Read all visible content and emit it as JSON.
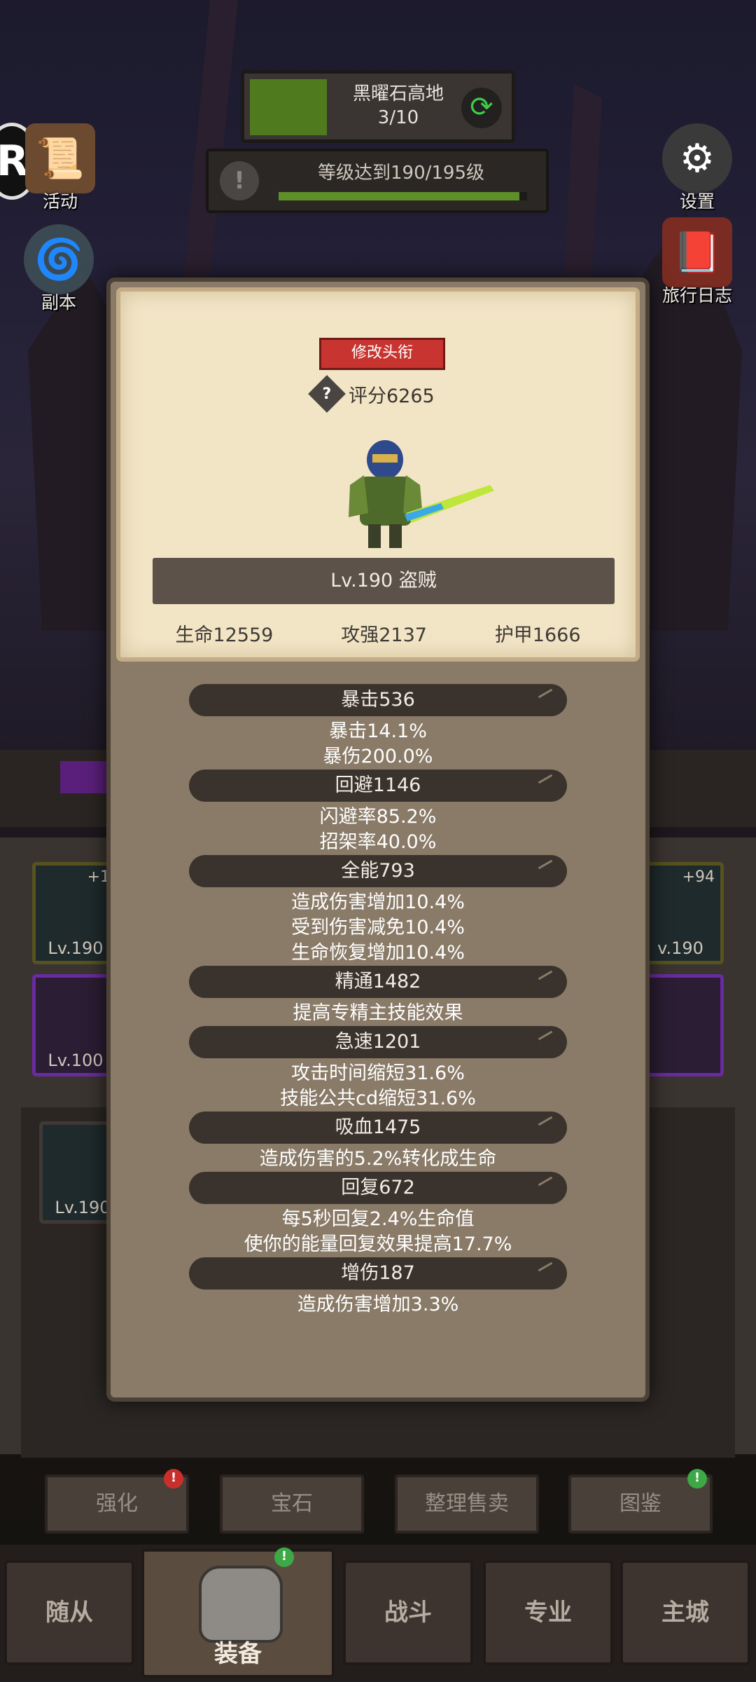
{
  "zone": {
    "name": "黑曜石高地",
    "progress_text": "3/10",
    "progress_fraction": 0.3
  },
  "quest": {
    "text": "等级达到190/195级",
    "progress_fraction": 0.97
  },
  "left_buttons": [
    {
      "label": "活动",
      "icon": "scroll-icon"
    },
    {
      "label": "副本",
      "icon": "portal-icon"
    }
  ],
  "right_buttons": [
    {
      "label": "设置",
      "icon": "gear-icon"
    },
    {
      "label": "旅行日志",
      "icon": "journal-icon"
    }
  ],
  "badge": {
    "letter": "R"
  },
  "inventory_slots": {
    "left_top": {
      "lv": "Lv.190",
      "plus": "+1"
    },
    "left_bottom": {
      "lv": "Lv.100"
    },
    "right_top": {
      "lv": "v.190",
      "plus": "+94"
    },
    "bag_first": {
      "lv": "Lv.190"
    }
  },
  "actions": [
    {
      "label": "强化",
      "badge": "!",
      "badge_color": "#c9302c"
    },
    {
      "label": "宝石"
    },
    {
      "label": "整理售卖"
    },
    {
      "label": "图鉴",
      "badge": "!",
      "badge_color": "#3ca846"
    }
  ],
  "nav": [
    {
      "label": "随从"
    },
    {
      "label": "装备",
      "active": true,
      "badge": "!"
    },
    {
      "label": "战斗"
    },
    {
      "label": "专业"
    },
    {
      "label": "主城"
    }
  ],
  "modal": {
    "title_button": "修改头衔",
    "score": "评分6265",
    "level_class": "Lv.190 盗贼",
    "stats": {
      "hp": "生命12559",
      "attack": "攻强2137",
      "armor": "护甲1666"
    },
    "attributes": [
      {
        "header": "暴击536",
        "lines": [
          "暴击14.1%",
          "暴伤200.0%"
        ]
      },
      {
        "header": "回避1146",
        "lines": [
          "闪避率85.2%",
          "招架率40.0%"
        ]
      },
      {
        "header": "全能793",
        "lines": [
          "造成伤害增加10.4%",
          "受到伤害减免10.4%",
          "生命恢复增加10.4%"
        ]
      },
      {
        "header": "精通1482",
        "lines": [
          "提高专精主技能效果"
        ]
      },
      {
        "header": "急速1201",
        "lines": [
          "攻击时间缩短31.6%",
          "技能公共cd缩短31.6%"
        ]
      },
      {
        "header": "吸血1475",
        "lines": [
          "造成伤害的5.2%转化成生命"
        ]
      },
      {
        "header": "回复672",
        "lines": [
          "每5秒回复2.4%生命值",
          "使你的能量回复效果提高17.7%"
        ]
      },
      {
        "header": "增伤187",
        "lines": [
          "造成伤害增加3.3%"
        ]
      }
    ]
  }
}
